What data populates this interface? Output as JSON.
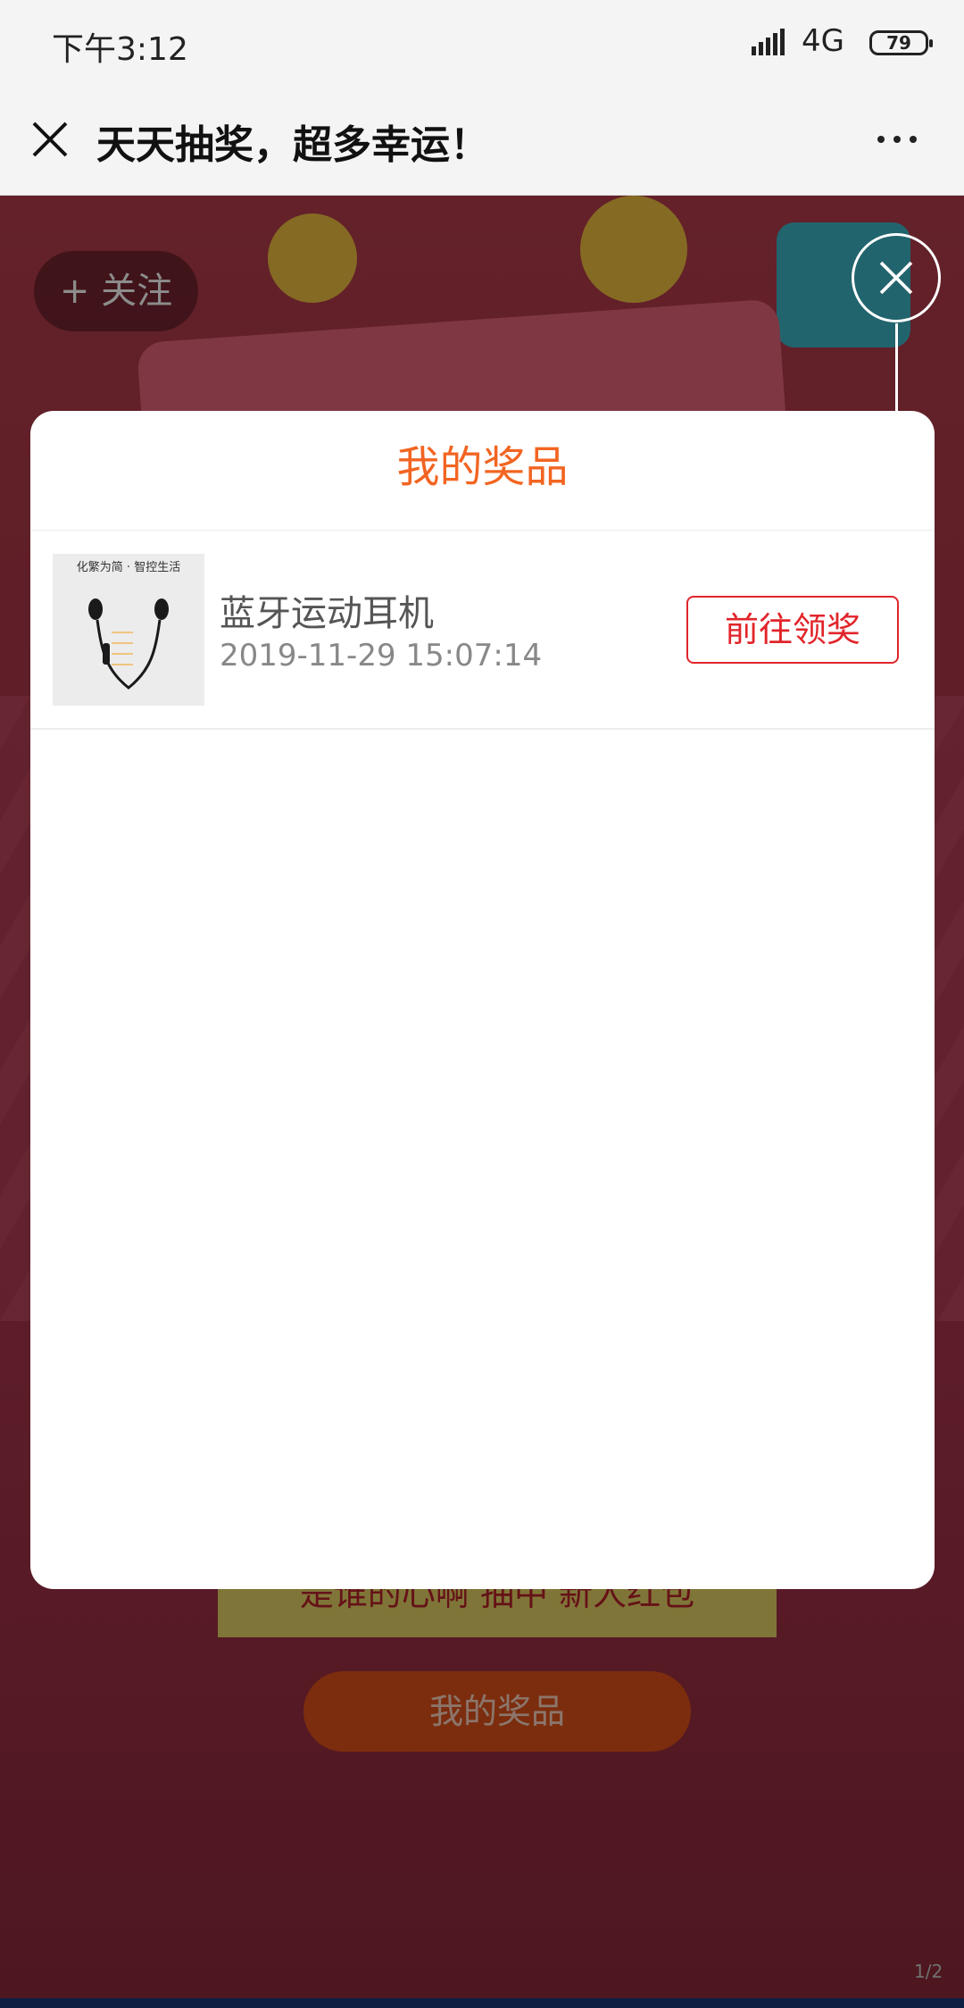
{
  "status_bar": {
    "time": "下午3:12",
    "network": "4G",
    "battery": "79"
  },
  "title_bar": {
    "title": "天天抽奖，超多幸运！"
  },
  "background": {
    "follow_label": "+ 关注",
    "banner_text": "是谁的心啊 抽中 新人红包",
    "prize_button_label": "我的奖品",
    "page_indicator": "1/2"
  },
  "modal": {
    "title": "我的奖品",
    "items": [
      {
        "thumb_caption": "化繁为简 · 智控生活",
        "name": "蓝牙运动耳机",
        "date": "2019-11-29 15:07:14",
        "action_label": "前往领奖"
      }
    ]
  },
  "colors": {
    "accent_orange": "#f26522",
    "claim_red": "#e1252b"
  }
}
